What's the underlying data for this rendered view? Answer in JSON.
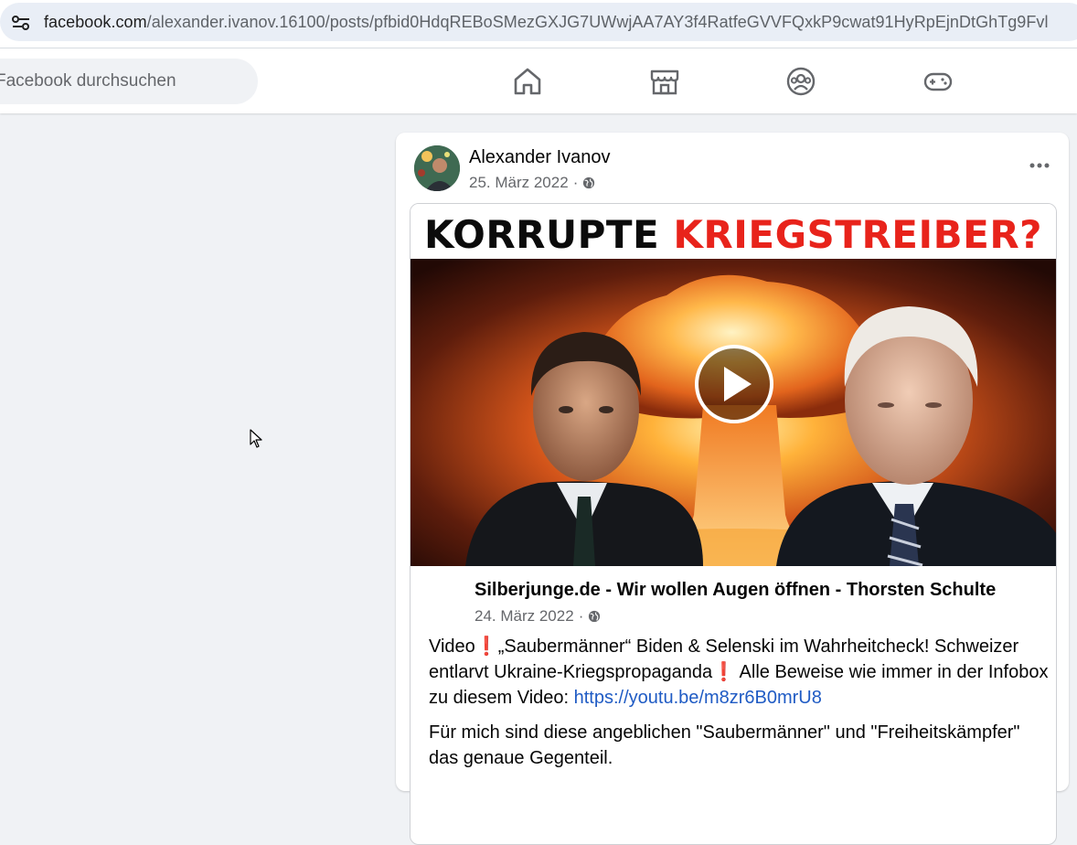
{
  "browser": {
    "url_host": "facebook.com",
    "url_path": "/alexander.ivanov.16100/posts/pfbid0HdqREBoSMezGXJG7UWwjAA7AY3f4RatfeGVVFQxkP9cwat91HyRpEjnDtGhTg9Fvl"
  },
  "nav": {
    "search_placeholder": "Facebook durchsuchen",
    "icons": [
      "home-icon",
      "marketplace-icon",
      "groups-icon",
      "gaming-icon"
    ]
  },
  "post": {
    "author": "Alexander Ivanov",
    "date": "25. März 2022",
    "separator": "·",
    "shared": {
      "banner_black": "KORRUPTE",
      "banner_red": "KRIEGSTREIBER?",
      "page_name": "Silberjunge.de - Wir wollen Augen öffnen - Thorsten Schulte",
      "date": "24. März 2022",
      "separator": "·",
      "p1_a": "Video",
      "p1_b": "„Saubermänner“ Biden & Selenski im Wahrheitcheck! Schweizer entlarvt Ukraine-Kriegspropaganda",
      "p1_c": "Alle Beweise wie immer in der Infobox zu diesem Video:",
      "link": "https://youtu.be/m8zr6B0mrU8",
      "p2": "Für mich sind diese angeblichen \"Saubermänner\" und \"Freiheitskämpfer\" das genaue Gegenteil.",
      "excl": "❗"
    }
  },
  "colors": {
    "fb_bg": "#f0f2f5",
    "link": "#1f5bc4",
    "banner_red": "#e8231b",
    "meta_gray": "#65676b"
  }
}
